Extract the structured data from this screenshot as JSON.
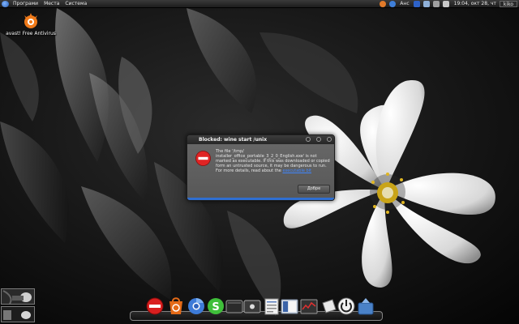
{
  "top_panel": {
    "menus": [
      "Програми",
      "Места",
      "Система"
    ],
    "tray_text": "Анс",
    "clock": "19:04, окт 28, чт",
    "user": "kiko"
  },
  "desktop_icons": [
    {
      "label": "avast! Free Antivirus",
      "icon": "avast-icon"
    }
  ],
  "dialog": {
    "title": "Blocked: wine start /unix",
    "message": "The file '/tmp/ installer_office_portable_3_2_0_English.exe' is not marked as executable.  If this was downloaded or copied form an untrusted source, it may be dangerous to run. For more details, read about the ",
    "link": "executable bit",
    "ok_label": "Добре",
    "icon": "stop-icon",
    "accent": "#2f6fd1"
  },
  "dock": {
    "items": [
      "stop-icon",
      "ubuntu-software-icon",
      "chromium-icon",
      "skype-icon",
      "terminal-icon",
      "media-player-icon",
      "text-editor-icon",
      "file-manager-icon",
      "system-monitor-icon",
      "note-icon",
      "power-icon",
      "update-manager-icon"
    ]
  }
}
